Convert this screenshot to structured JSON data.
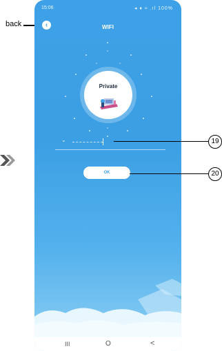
{
  "status_bar": {
    "time": "15:06",
    "icons_right": "◂ ♦ ≈ .ıl 100%"
  },
  "header": {
    "title": "WIFI",
    "back_symbol": "‹"
  },
  "network": {
    "name": "Private"
  },
  "password": {
    "chevron": "⌄"
  },
  "ok_button": {
    "label": "OK"
  },
  "nav_bar": {
    "recent": "III",
    "home": "O",
    "back": "<"
  },
  "annotations": {
    "back_label": "back",
    "callout_19": "19",
    "callout_20": "20"
  },
  "colors": {
    "background_top": "#3ea0e6",
    "background_bottom": "#8fd0f4",
    "button": "#ffffff"
  }
}
